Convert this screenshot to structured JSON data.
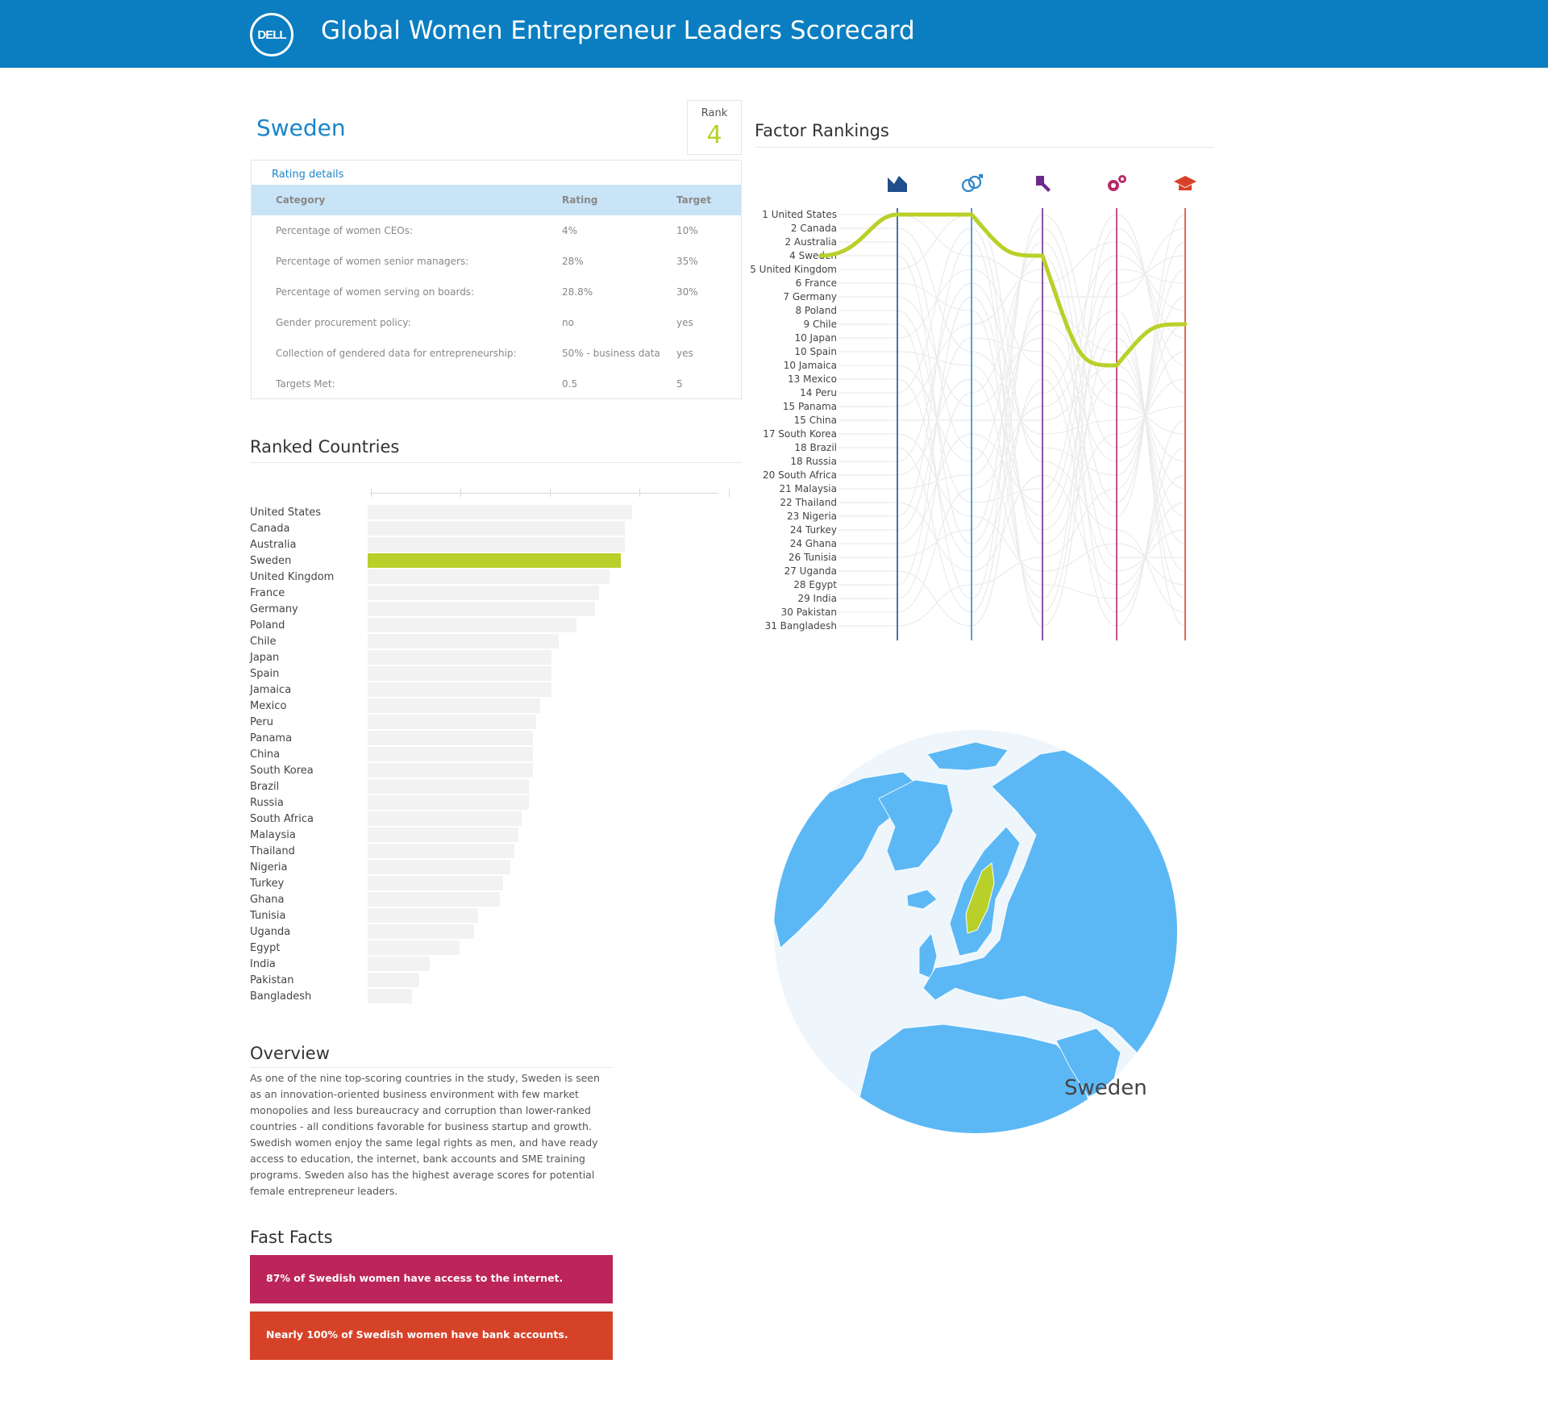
{
  "header": {
    "logo": "DELL",
    "title": "Global Women Entrepreneur Leaders Scorecard"
  },
  "country": {
    "name": "Sweden",
    "rank_label": "Rank",
    "rank": "4"
  },
  "details": {
    "link": "Rating details",
    "columns": [
      "Category",
      "Rating",
      "Target"
    ],
    "rows": [
      [
        "Percentage of women CEOs:",
        "4%",
        "10%"
      ],
      [
        "Percentage of women senior managers:",
        "28%",
        "35%"
      ],
      [
        "Percentage of women serving on boards:",
        "28.8%",
        "30%"
      ],
      [
        "Gender procurement policy:",
        "no",
        "yes"
      ],
      [
        "Collection of gendered data for entrepreneurship:",
        "50% - business data",
        "yes"
      ],
      [
        "Targets Met:",
        "0.5",
        "5"
      ]
    ]
  },
  "ranked": {
    "title": "Ranked Countries",
    "highlight": "Sweden",
    "colors": {
      "bar": "#f2f2f2",
      "highlight": "#bad02a"
    },
    "chart_data": {
      "type": "bar",
      "categories": [
        "United States",
        "Canada",
        "Australia",
        "Sweden",
        "United Kingdom",
        "France",
        "Germany",
        "Poland",
        "Chile",
        "Japan",
        "Spain",
        "Jamaica",
        "Mexico",
        "Peru",
        "Panama",
        "China",
        "South Korea",
        "Brazil",
        "Russia",
        "South Africa",
        "Malaysia",
        "Thailand",
        "Nigeria",
        "Turkey",
        "Ghana",
        "Tunisia",
        "Uganda",
        "Egypt",
        "India",
        "Pakistan",
        "Bangladesh"
      ],
      "values": [
        72,
        70,
        70,
        69,
        66,
        63,
        62,
        57,
        52,
        50,
        50,
        50,
        47,
        46,
        45,
        45,
        45,
        44,
        44,
        42,
        41,
        40,
        39,
        37,
        36,
        30,
        29,
        25,
        17,
        14,
        12
      ],
      "xlim": [
        0,
        95
      ]
    }
  },
  "factor": {
    "title": "Factor Rankings",
    "icons": [
      {
        "name": "area-chart-icon",
        "color": "#1f4e8c"
      },
      {
        "name": "gender-icon",
        "color": "#2e86c8"
      },
      {
        "name": "gavel-icon",
        "color": "#6b2a8a"
      },
      {
        "name": "gears-icon",
        "color": "#b52a6b"
      },
      {
        "name": "graduation-cap-icon",
        "color": "#d64228"
      }
    ],
    "ranks": [
      "1",
      "2",
      "2",
      "4",
      "5",
      "6",
      "7",
      "8",
      "9",
      "10",
      "10",
      "10",
      "13",
      "14",
      "15",
      "15",
      "17",
      "18",
      "18",
      "20",
      "21",
      "22",
      "23",
      "24",
      "24",
      "26",
      "27",
      "28",
      "29",
      "30",
      "31"
    ],
    "highlight_ranks": [
      4,
      1,
      4,
      12,
      9
    ],
    "highlight_color": "#bad02a"
  },
  "map": {
    "label": "Sweden",
    "land": "#5cb8f5",
    "highlight": "#bad02a",
    "ocean": "#eef6fc"
  },
  "overview": {
    "title": "Overview",
    "text": "As one of the nine top-scoring countries in the study, Sweden is seen as an innovation-oriented business environment with few market monopolies and less bureaucracy and corruption than lower-ranked countries - all conditions favorable for business startup and growth. Swedish women enjoy the same legal rights as men, and have ready access to education, the internet, bank accounts and SME training programs. Sweden also has the highest average scores for potential female entrepreneur leaders."
  },
  "facts": {
    "title": "Fast Facts",
    "items": [
      "87% of Swedish women have access to the internet.",
      "Nearly 100% of Swedish women have bank accounts."
    ]
  }
}
